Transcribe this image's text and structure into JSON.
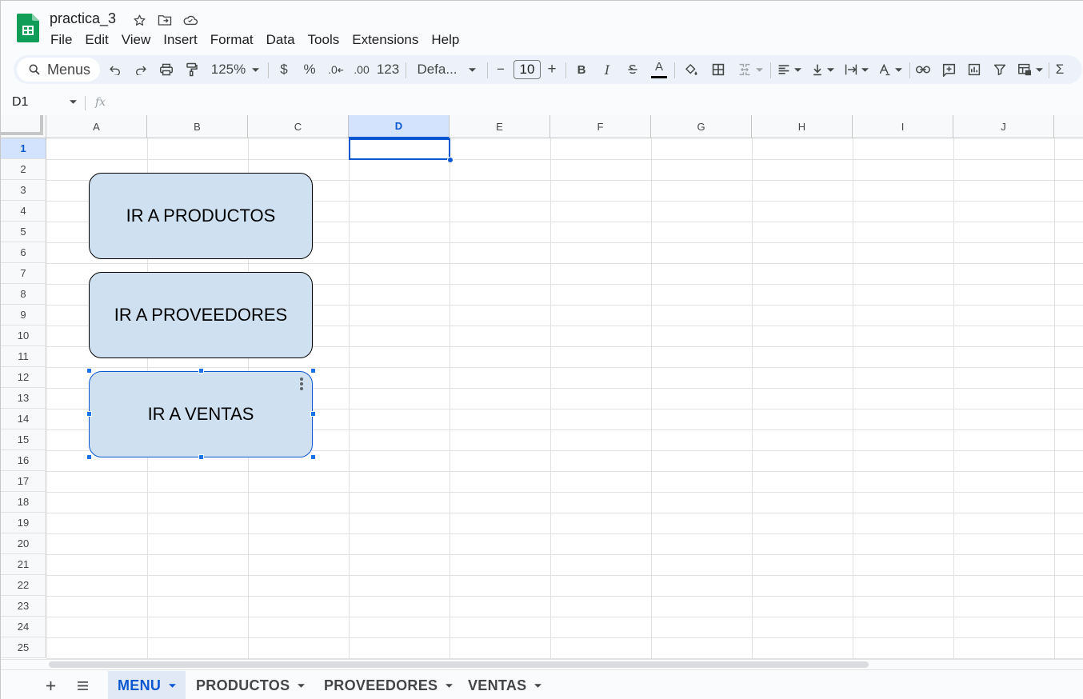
{
  "document": {
    "title": "practica_3"
  },
  "menubar": [
    "File",
    "Edit",
    "View",
    "Insert",
    "Format",
    "Data",
    "Tools",
    "Extensions",
    "Help"
  ],
  "toolbar": {
    "search_label": "Menus",
    "zoom": "125%",
    "currency": "$",
    "percent": "%",
    "decrease_decimals": ".0",
    "increase_decimals": ".00",
    "number_format": "123",
    "font_family": "Defa...",
    "font_size": "10",
    "minus": "−",
    "plus": "+",
    "bold": "B",
    "italic": "I",
    "text_color_label": "A",
    "sigma": "Σ"
  },
  "formula_bar": {
    "name_box": "D1",
    "fx_label": "fx"
  },
  "columns": [
    "A",
    "B",
    "C",
    "D",
    "E",
    "F",
    "G",
    "H",
    "I",
    "J"
  ],
  "rows": [
    "1",
    "2",
    "3",
    "4",
    "5",
    "6",
    "7",
    "8",
    "9",
    "10",
    "11",
    "12",
    "13",
    "14",
    "15",
    "16",
    "17",
    "18",
    "19",
    "20",
    "21",
    "22",
    "23",
    "24",
    "25"
  ],
  "selected_cell": "D1",
  "shapes": [
    {
      "label": "IR A PRODUCTOS"
    },
    {
      "label": "IR A PROVEEDORES"
    },
    {
      "label": "IR A VENTAS"
    }
  ],
  "sheet_tabs": [
    "MENU",
    "PRODUCTOS",
    "PROVEEDORES",
    "VENTAS"
  ],
  "active_sheet": "MENU",
  "colors": {
    "accent": "#0b57d0",
    "shape_fill": "#cfe0f1",
    "toolbar_bg": "#edf2fa",
    "sheets_green": "#0f9d58"
  }
}
